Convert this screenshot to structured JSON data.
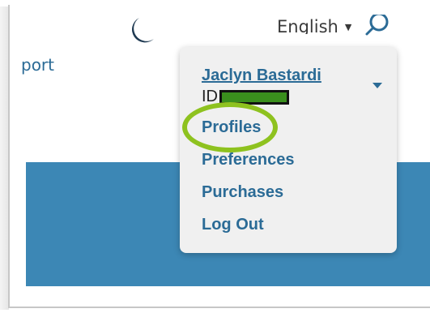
{
  "header": {
    "language_label": "English",
    "icons": [
      "moon-icon",
      "search-icon",
      "chevron-down-icon"
    ]
  },
  "nav": {
    "fragment_text": "port"
  },
  "account_menu": {
    "user_name": "Jaclyn Bastardi",
    "id_label": "ID",
    "items": [
      {
        "label": "Profiles",
        "highlighted": true
      },
      {
        "label": "Preferences"
      },
      {
        "label": "Purchases"
      },
      {
        "label": "Log Out"
      }
    ]
  },
  "colors": {
    "link_blue": "#2b6b96",
    "banner_blue": "#3c87b5",
    "highlight_green": "#8ec21f",
    "redaction_green": "#3a8f1d",
    "dropdown_bg": "#f0f0f0"
  }
}
